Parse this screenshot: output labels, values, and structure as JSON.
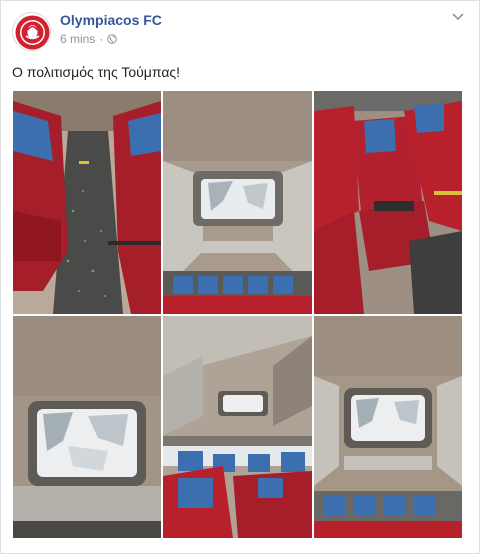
{
  "post": {
    "page_name": "Olympiacos FC",
    "timestamp": "6 mins",
    "separator": "·",
    "privacy_icon": "globe-icon",
    "menu_icon": "chevron-down-icon",
    "text": "Ο πολιτισμός της Τούμπας!"
  },
  "photos": [
    {
      "subject": "bus-aisle-glass"
    },
    {
      "subject": "bus-roof-hatch-broken"
    },
    {
      "subject": "bus-seat-damaged"
    },
    {
      "subject": "bus-roof-hatch-broken-closeup"
    },
    {
      "subject": "bus-interior-ceiling"
    },
    {
      "subject": "bus-roof-hatch-broken-wide"
    }
  ],
  "colors": {
    "page_name": "#365899",
    "meta": "#90949c",
    "seat_red": "#b8202c",
    "seat_blue": "#3c6fb0",
    "ceiling": "#9c8f82"
  }
}
